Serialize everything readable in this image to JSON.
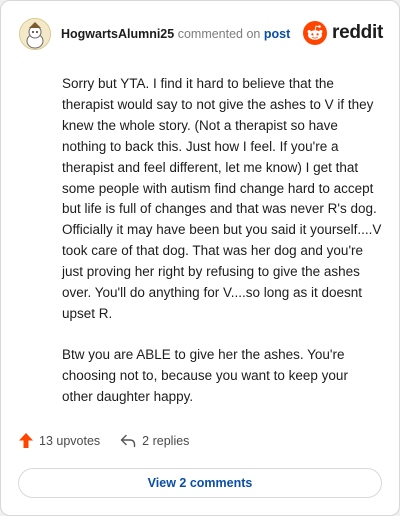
{
  "header": {
    "username": "HogwartsAlumni25",
    "action_text": "commented on",
    "post_link": "post",
    "logo_text": "reddit"
  },
  "comment": {
    "paragraphs": [
      "Sorry but YTA. I find it hard to believe that the therapist would say to not give the ashes to V if they knew the whole story. (Not a therapist so have nothing to back this. Just how I feel. If you're a therapist and feel different, let me know) I get that some people with autism find change hard to accept but life is full of changes and that was never R's dog. Officially it may have been but you said it yourself....V took care of that dog. That was her dog and you're just proving her right by refusing to give the ashes over. You'll do anything for V....so long as it doesnt upset R.",
      "Btw you are ABLE to give her the ashes. You're choosing not to, because you want to keep your other daughter happy."
    ]
  },
  "actions": {
    "upvotes": "13 upvotes",
    "replies": "2 replies",
    "view_comments": "View 2 comments"
  },
  "colors": {
    "upvote": "#ff4500",
    "link": "#0a4fa6",
    "reddit_orange": "#ff4500"
  },
  "icons": {
    "avatar": "avatar-icon",
    "logo": "reddit-snoo-icon",
    "upvote": "upvote-arrow-icon",
    "reply": "reply-arrow-icon"
  }
}
